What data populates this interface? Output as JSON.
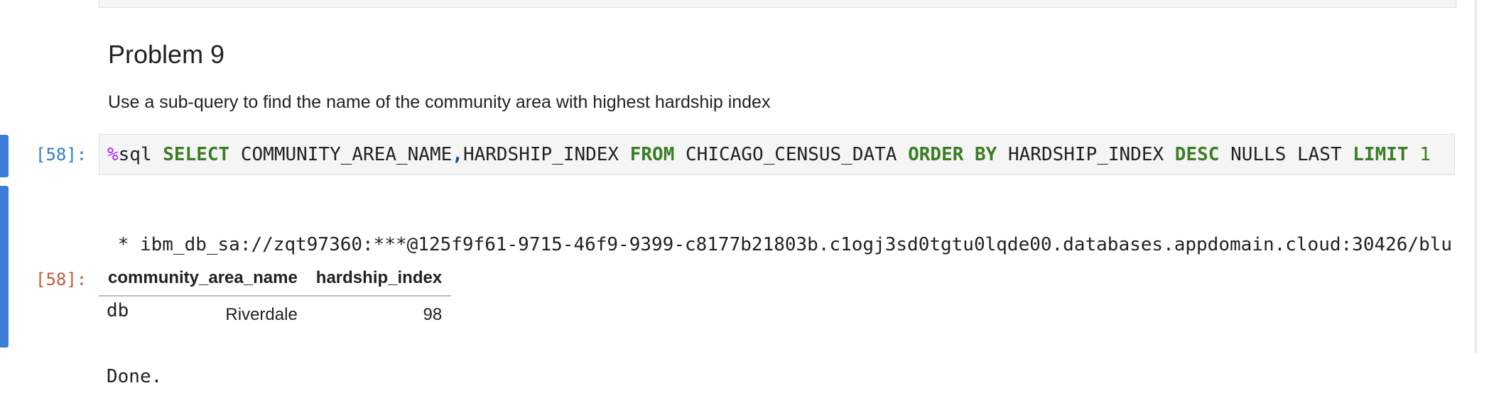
{
  "markdown": {
    "heading": "Problem 9",
    "description": "Use a sub-query to find the name of the community area with highest hardship index"
  },
  "code_cell": {
    "prompt": "[58]:",
    "tokens": {
      "magic_pct": "%",
      "magic_name": "sql ",
      "kw_select": "SELECT",
      "col1": " COMMUNITY_AREA_NAME",
      "comma": ",",
      "col2": "HARDSHIP_INDEX ",
      "kw_from": "FROM",
      "table": " CHICAGO_CENSUS_DATA ",
      "kw_order": "ORDER BY",
      "order_col": " HARDSHIP_INDEX ",
      "kw_desc": "DESC",
      "nulls": " NULLS LAST ",
      "kw_limit": "LIMIT",
      "limit_val": " 1"
    }
  },
  "output": {
    "stream_lines": [
      " * ibm_db_sa://zqt97360:***@125f9f61-9715-46f9-9399-c8177b21803b.c1ogj3sd0tgtu0lqde00.databases.appdomain.cloud:30426/blu",
      "db",
      "Done."
    ],
    "prompt": "[58]:",
    "table": {
      "headers": [
        "community_area_name",
        "hardship_index"
      ],
      "rows": [
        [
          "Riverdale",
          "98"
        ]
      ]
    }
  }
}
